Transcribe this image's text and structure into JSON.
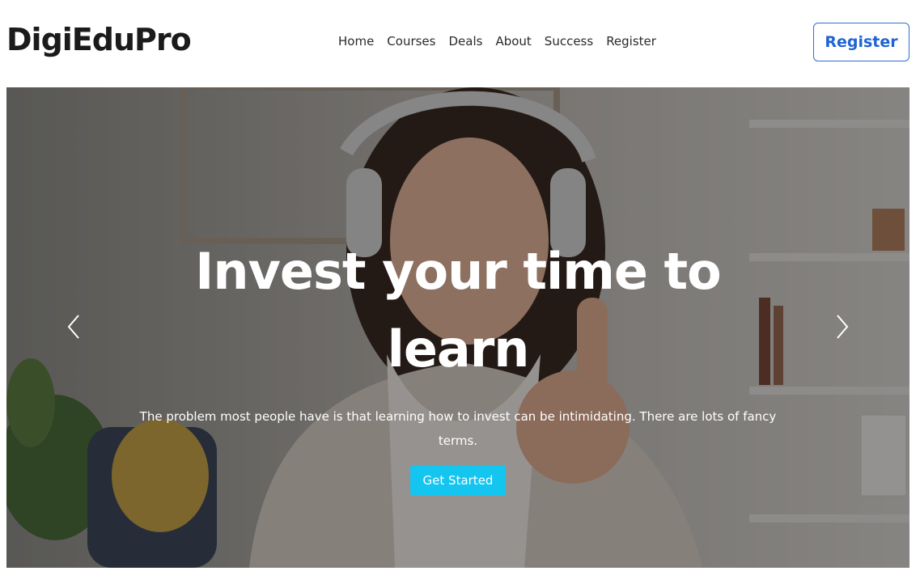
{
  "header": {
    "logo": "DigiEduPro",
    "nav": [
      "Home",
      "Courses",
      "Deals",
      "About",
      "Success",
      "Register"
    ],
    "register_button": "Register"
  },
  "hero": {
    "title": "Invest your time to learn",
    "text": "The problem most people have is that learning how to invest can be intimidating. There are lots of fancy terms.",
    "cta": "Get Started",
    "prev_icon": "chevron-left-icon",
    "next_icon": "chevron-right-icon"
  },
  "colors": {
    "accent": "#13c5ef",
    "brand_blue": "#1f63d4",
    "logo": "#1b1b1b"
  }
}
